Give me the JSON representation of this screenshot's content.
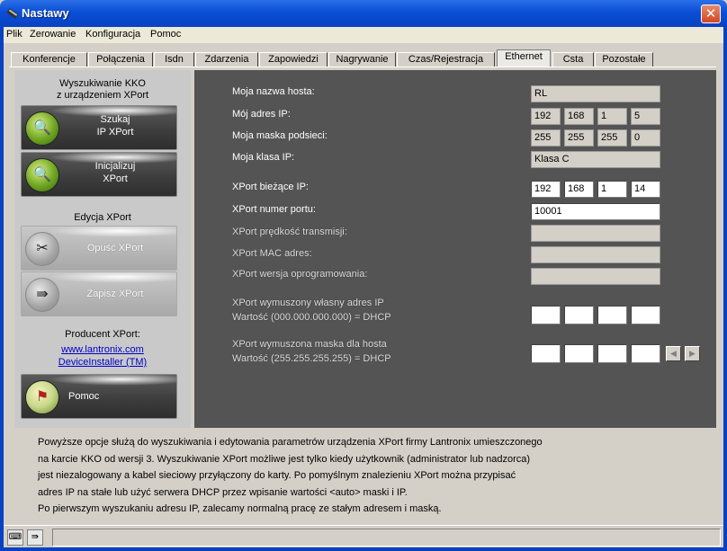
{
  "window": {
    "title": "Nastawy",
    "close_glyph": "✕"
  },
  "menu": [
    "Plik",
    "Zerowanie",
    "Konfiguracja",
    "Pomoc"
  ],
  "tabs": [
    "Konferencje",
    "Połączenia",
    "Isdn",
    "Zdarzenia",
    "Zapowiedzi",
    "Nagrywanie",
    "Czas/Rejestracja",
    "Ethernet",
    "Csta",
    "Pozostałe"
  ],
  "active_tab": "Ethernet",
  "left": {
    "search_heading_1": "Wyszukiwanie KKO",
    "search_heading_2": "z urządzeniem XPort",
    "btn_search_1": "Szukaj",
    "btn_search_2": "IP XPort",
    "btn_init_1": "Inicjalizuj",
    "btn_init_2": "XPort",
    "edit_heading": "Edycja XPort",
    "btn_leave": "Opuść XPort",
    "btn_save": "Zapisz XPort",
    "producer_heading": "Producent XPort:",
    "link_1": "www.lantronix.com",
    "link_2": "DeviceInstaller (TM)",
    "btn_help": "Pomoc"
  },
  "right": {
    "host_label": "Moja nazwa hosta:",
    "host_value": "RL",
    "ip_label": "Mój adres IP:",
    "ip": [
      "192",
      "168",
      "1",
      "5"
    ],
    "mask_label": "Moja maska podsieci:",
    "mask": [
      "255",
      "255",
      "255",
      "0"
    ],
    "class_label": "Moja klasa IP:",
    "class_value": "Klasa C",
    "xport_ip_label": "XPort bieżące IP:",
    "xport_ip": [
      "192",
      "168",
      "1",
      "14"
    ],
    "port_label": "XPort numer portu:",
    "port_value": "10001",
    "speed_label": "XPort prędkość transmisji:",
    "mac_label": "XPort MAC adres:",
    "fw_label": "XPort wersja oprogramowania:",
    "forced_ip_label_1": "XPort wymuszony własny adres IP",
    "forced_ip_label_2": "Wartość (000.000.000.000) = DHCP",
    "forced_mask_label_1": "XPort wymuszona maska dla hosta",
    "forced_mask_label_2": "Wartość (255.255.255.255) = DHCP"
  },
  "description": [
    "Powyższe opcje służą do wyszukiwania i edytowania parametrów urządzenia XPort firmy Lantronix umieszczonego",
    "na karcie KKO od wersji 3. Wyszukiwanie XPort możliwe jest tylko kiedy użytkownik (administrator lub nadzorca)",
    "jest niezalogowany a kabel sieciowy przyłączony do karty. Po pomyślnym znalezieniu XPort można przypisać",
    "adres IP na stałe lub użyć serwera DHCP przez wpisanie wartości <auto> maski i IP.",
    "Po pierwszym wyszukaniu adresu IP, zalecamy normalną pracę ze stałym adresem i maską."
  ]
}
